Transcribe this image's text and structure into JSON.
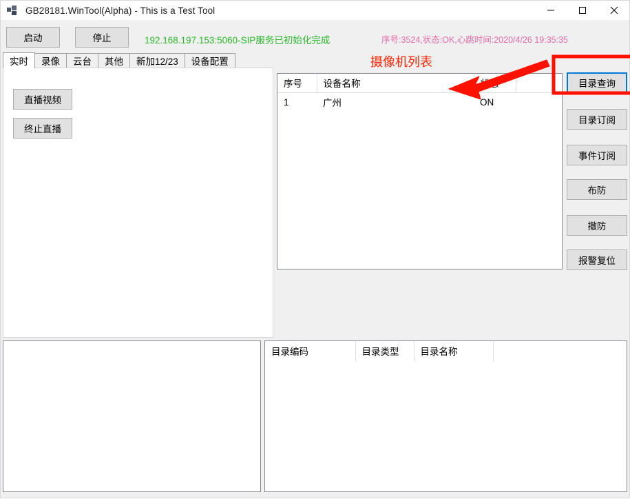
{
  "window": {
    "title": "GB28181.WinTool(Alpha) - This is a Test Tool",
    "icon": "app-window-icon",
    "controls": {
      "minimize": "minimize-icon",
      "maximize": "maximize-icon",
      "close": "close-icon"
    }
  },
  "toolbar": {
    "start_label": "启动",
    "stop_label": "停止",
    "status_green": "192.168.197.153:5060-SIP服务已初始化完成",
    "status_pink": "序号:3524,状态:OK,心跳时间:2020/4/26 19:35:35",
    "status_green_color": "#2ab82a",
    "status_pink_color": "#e36ba8"
  },
  "tabs": [
    {
      "label": "实时",
      "active": true
    },
    {
      "label": "录像",
      "active": false
    },
    {
      "label": "云台",
      "active": false
    },
    {
      "label": "其他",
      "active": false
    },
    {
      "label": "新加12/23",
      "active": false
    },
    {
      "label": "设备配置",
      "active": false
    }
  ],
  "tab_panel": {
    "live_video_label": "直播视频",
    "stop_live_label": "终止直播"
  },
  "camera_list": {
    "title": "摄像机列表",
    "title_color": "#ff2400",
    "columns": [
      "序号",
      "设备名称",
      "状态",
      ""
    ],
    "rows": [
      [
        "1",
        "广州",
        "ON",
        ""
      ]
    ]
  },
  "side_buttons": [
    {
      "label": "目录查询",
      "focused": true
    },
    {
      "label": "目录订阅",
      "focused": false
    },
    {
      "label": "事件订阅",
      "focused": false
    },
    {
      "label": "布防",
      "focused": false
    },
    {
      "label": "撤防",
      "focused": false
    },
    {
      "label": "报警复位",
      "focused": false
    }
  ],
  "bottom_left": {
    "content": ""
  },
  "directory_table": {
    "columns": [
      "目录编码",
      "目录类型",
      "目录名称",
      ""
    ],
    "rows": []
  },
  "annotations": {
    "highlight_color": "#ff1100",
    "arrow_color": "#ff1100",
    "focus_color": "#0078d7"
  }
}
